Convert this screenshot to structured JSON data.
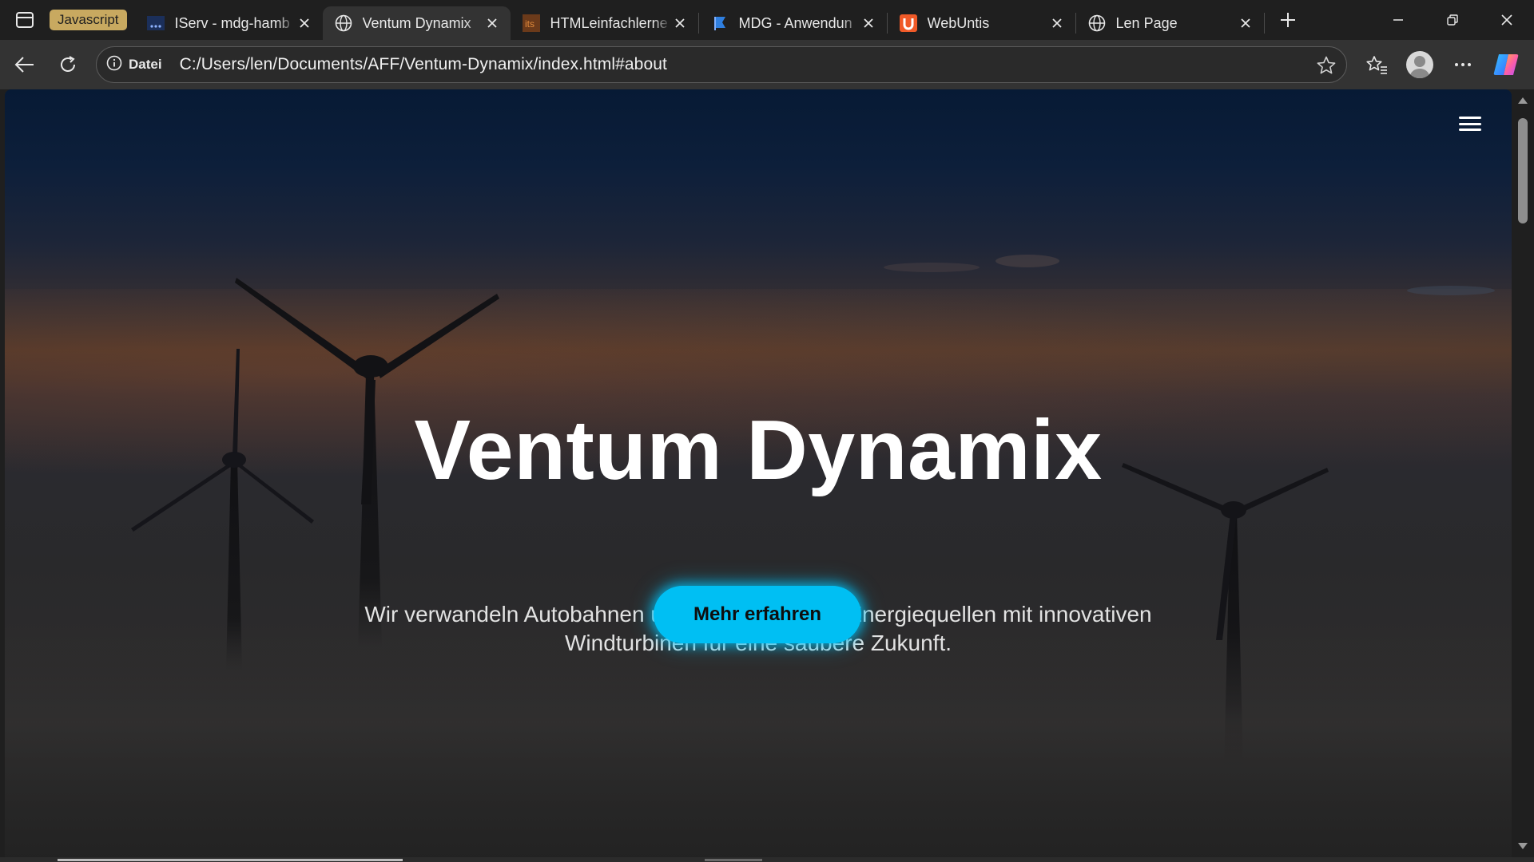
{
  "tab_group": {
    "label": "Javascript",
    "color": "#c8a960"
  },
  "tabs": [
    {
      "title": "IServ - mdg-hamb",
      "icon": "iserv-icon",
      "active": false
    },
    {
      "title": "Ventum Dynamix",
      "icon": "globe-icon",
      "active": true
    },
    {
      "title": "HTMLeinfachlerne",
      "icon": "its-icon",
      "active": false
    },
    {
      "title": "MDG - Anwendun",
      "icon": "flag-icon",
      "active": false
    },
    {
      "title": "WebUntis",
      "icon": "untis-icon",
      "active": false
    },
    {
      "title": "Len Page",
      "icon": "globe-icon",
      "active": false
    }
  ],
  "address_bar": {
    "security_label": "Datei",
    "url": "C:/Users/len/Documents/AFF/Ventum-Dynamix/index.html#about"
  },
  "page": {
    "hero_title": "Ventum Dynamix",
    "hero_subtitle": "Wir verwandeln Autobahnen und Zugstrecken in Energiequellen mit innovativen Windturbinen für eine saubere Zukunft.",
    "cta_label": "Mehr erfahren",
    "accent_color": "#00bff3"
  }
}
